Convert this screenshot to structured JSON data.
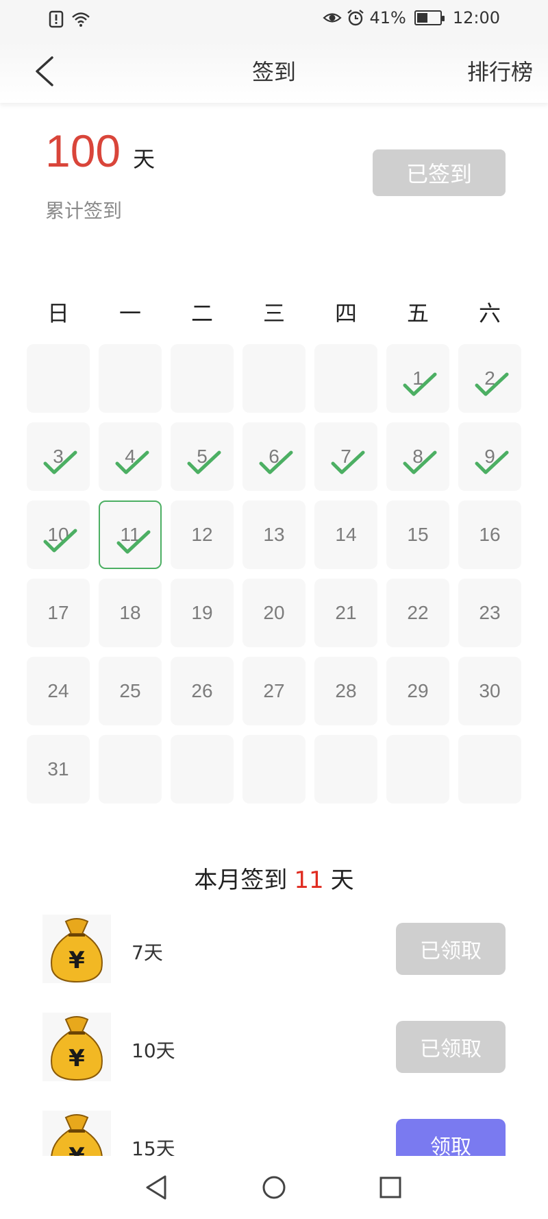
{
  "status_bar": {
    "battery_percent": "41%",
    "time": "12:00",
    "battery_level": 0.41,
    "icons": [
      "alert-icon",
      "wifi-icon",
      "eye-icon",
      "alarm-icon",
      "battery-icon"
    ]
  },
  "header": {
    "title": "签到",
    "leaderboard_label": "排行榜"
  },
  "summary": {
    "total_days": "100",
    "unit": "天",
    "label": "累计签到",
    "signed_button": "已签到"
  },
  "calendar": {
    "weekdays": [
      "日",
      "一",
      "二",
      "三",
      "四",
      "五",
      "六"
    ],
    "first_weekday_index": 5,
    "days_in_month": 31,
    "checked_days": [
      1,
      2,
      3,
      4,
      5,
      6,
      7,
      8,
      9,
      10,
      11
    ],
    "today": 11
  },
  "month_summary": {
    "prefix": "本月签到",
    "count": "11",
    "suffix": "天"
  },
  "rewards": [
    {
      "days": "7天",
      "button": "已领取",
      "state": "done",
      "icon": "money-bag-icon"
    },
    {
      "days": "10天",
      "button": "已领取",
      "state": "done",
      "icon": "money-bag-icon"
    },
    {
      "days": "15天",
      "button": "领取",
      "state": "claim",
      "icon": "money-bag-icon"
    }
  ],
  "colors": {
    "accent_red": "#d9453a",
    "check_green": "#4caf63",
    "claim_purple": "#7a7af0",
    "disabled_gray": "#cfcfcf"
  }
}
